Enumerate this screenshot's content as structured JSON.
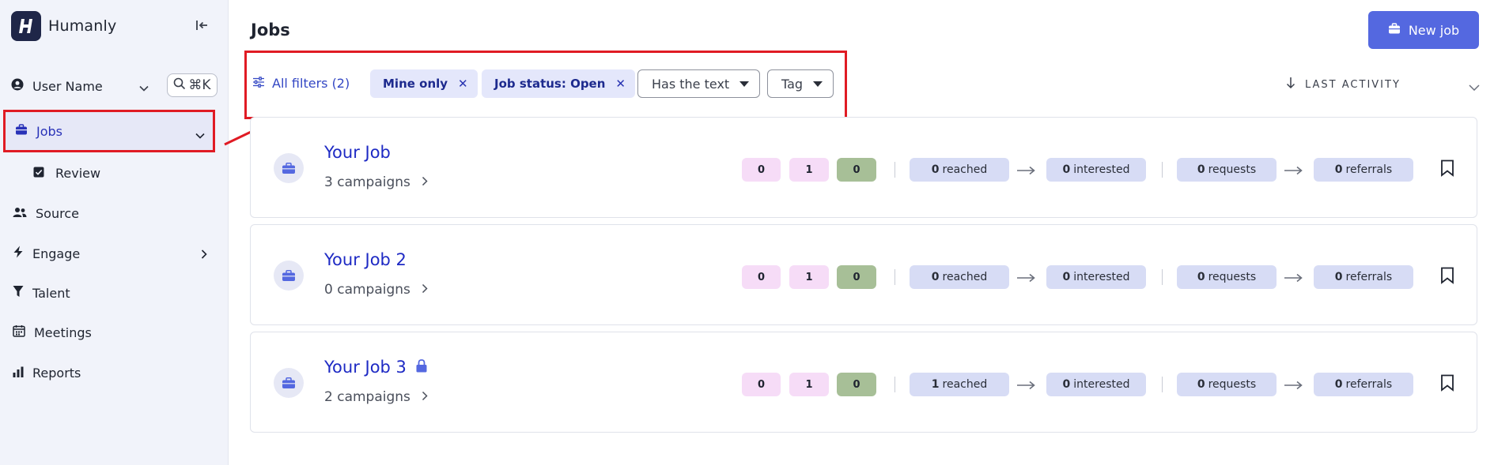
{
  "brand": {
    "name": "Humanly",
    "logo_letter": "H"
  },
  "user": {
    "name": "User Name",
    "shortcut": "⌘K"
  },
  "nav": {
    "jobs": "Jobs",
    "review": "Review",
    "source": "Source",
    "engage": "Engage",
    "talent": "Talent",
    "meetings": "Meetings",
    "reports": "Reports"
  },
  "header": {
    "title": "Jobs",
    "new_job_label": "New job"
  },
  "filters": {
    "all_filters_label": "All filters (2)",
    "chip1": "Mine only",
    "chip2": "Job status: Open",
    "has_text": "Has the text",
    "tag": "Tag",
    "remove_symbol": "✕"
  },
  "sort": {
    "label": "LAST ACTIVITY"
  },
  "jobs": [
    {
      "title": "Your Job",
      "campaigns": "3 campaigns",
      "locked": false,
      "counts": [
        "0",
        "1",
        "0"
      ],
      "reached_n": "0",
      "reached_lbl": "reached",
      "interested_n": "0",
      "interested_lbl": "interested",
      "requests_n": "0",
      "requests_lbl": "requests",
      "referrals_n": "0",
      "referrals_lbl": "referrals"
    },
    {
      "title": "Your Job 2",
      "campaigns": "0 campaigns",
      "locked": false,
      "counts": [
        "0",
        "1",
        "0"
      ],
      "reached_n": "0",
      "reached_lbl": "reached",
      "interested_n": "0",
      "interested_lbl": "interested",
      "requests_n": "0",
      "requests_lbl": "requests",
      "referrals_n": "0",
      "referrals_lbl": "referrals"
    },
    {
      "title": "Your Job 3",
      "campaigns": "2 campaigns",
      "locked": true,
      "counts": [
        "0",
        "1",
        "0"
      ],
      "reached_n": "1",
      "reached_lbl": "reached",
      "interested_n": "0",
      "interested_lbl": "interested",
      "requests_n": "0",
      "requests_lbl": "requests",
      "referrals_n": "0",
      "referrals_lbl": "referrals"
    }
  ],
  "colors": {
    "accent": "#5468e0",
    "highlight_red": "#e01b24",
    "sidebar_bg": "#f1f3fa",
    "link_blue": "#1e2ac4"
  }
}
